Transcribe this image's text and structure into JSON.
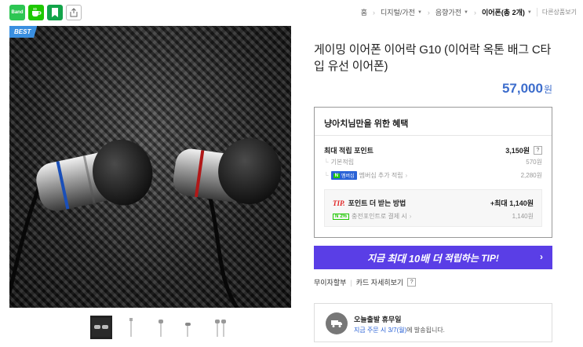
{
  "share": {
    "band_label": "Band",
    "icons": [
      "band-icon",
      "cafe-icon",
      "bookmark-icon",
      "share-icon"
    ]
  },
  "breadcrumb": {
    "items": [
      "홈",
      "디지털/가전",
      "음향가전",
      "이어폰"
    ],
    "count_label": "(총 2개)",
    "next_label": "다른상품보기"
  },
  "product": {
    "badge": "BEST",
    "title": "게이밍 이어폰 이어락 G10 (이어락 옥톤 배그 C타입 유선 이어폰)",
    "price": "57,000",
    "price_unit": "원"
  },
  "benefits": {
    "title": "냥아치님만을 위한 혜택",
    "max_points_label": "최대 적립 포인트",
    "max_points_value": "3,150원",
    "basic_label": "기본적립",
    "basic_value": "570원",
    "member_tag_n": "N",
    "member_tag_label": "멤버십",
    "member_label": "멤버십 추가 적립",
    "member_value": "2,280원",
    "tip_label": "TIP.",
    "tip_text": "포인트 더 받는 방법",
    "tip_value": "+최대 1,140원",
    "charge_pct": "2%",
    "charge_label": "충전포인트로 결제 시",
    "charge_value": "1,140원"
  },
  "cta": {
    "prefix": "지금",
    "strong": "최대 10배 더",
    "suffix": "적립하는 TIP!"
  },
  "links": {
    "interest_free": "무이자할부",
    "card_detail": "카드 자세히보기"
  },
  "delivery": {
    "title": "오늘출발 휴무일",
    "sub_prefix": "지금 주문 시",
    "sub_date": "3/7(월)",
    "sub_suffix": "에 발송됩니다."
  },
  "colors": {
    "accent_price": "#3d6dcc",
    "cta_bg": "#5a3ee6",
    "naver_green": "#1ec800",
    "tip_red": "#e02020"
  }
}
